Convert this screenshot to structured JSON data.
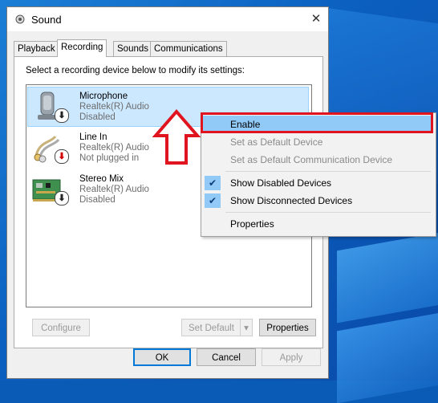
{
  "window": {
    "title": "Sound",
    "close_glyph": "✕"
  },
  "tabs": [
    {
      "label": "Playback"
    },
    {
      "label": "Recording"
    },
    {
      "label": "Sounds"
    },
    {
      "label": "Communications"
    }
  ],
  "instruction": "Select a recording device below to modify its settings:",
  "devices": [
    {
      "name": "Microphone",
      "driver": "Realtek(R) Audio",
      "status": "Disabled",
      "icon": "microphone-icon",
      "badge": "down-arrow"
    },
    {
      "name": "Line In",
      "driver": "Realtek(R) Audio",
      "status": "Not plugged in",
      "icon": "line-in-cable-icon",
      "badge": "red-down-arrow"
    },
    {
      "name": "Stereo Mix",
      "driver": "Realtek(R) Audio",
      "status": "Disabled",
      "icon": "sound-card-icon",
      "badge": "down-arrow"
    }
  ],
  "buttons": {
    "configure": "Configure",
    "set_default": "Set Default",
    "properties": "Properties",
    "ok": "OK",
    "cancel": "Cancel",
    "apply": "Apply"
  },
  "context_menu": {
    "items": [
      {
        "label": "Enable",
        "state": "highlighted"
      },
      {
        "label": "Set as Default Device",
        "state": "disabled"
      },
      {
        "label": "Set as Default Communication Device",
        "state": "disabled"
      },
      {
        "label": "Show Disabled Devices",
        "state": "checked"
      },
      {
        "label": "Show Disconnected Devices",
        "state": "checked"
      },
      {
        "label": "Properties",
        "state": "normal"
      }
    ]
  },
  "annotation": {
    "highlight_color": "#e0141e",
    "arrow": "up-arrow"
  }
}
